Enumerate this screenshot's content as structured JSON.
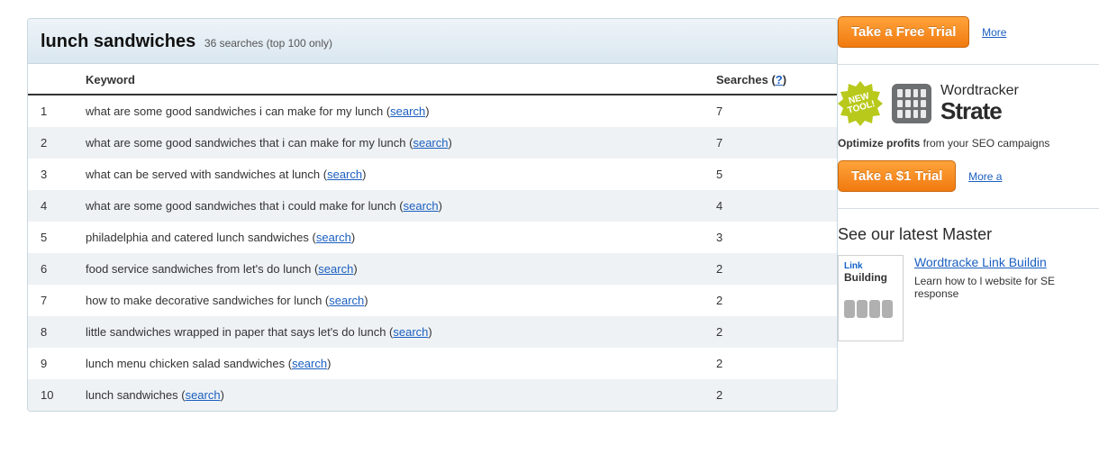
{
  "main": {
    "title": "lunch sandwiches",
    "subtitle": "36 searches (top 100 only)",
    "columns": {
      "keyword": "Keyword",
      "searches": "Searches",
      "help": "?"
    },
    "searchLinkLabel": "search",
    "rows": [
      {
        "rank": "1",
        "text": "what are some good sandwiches i can make for my lunch",
        "count": "7"
      },
      {
        "rank": "2",
        "text": "what are some good sandwiches that i can make for my lunch",
        "count": "7"
      },
      {
        "rank": "3",
        "text": "what can be served with sandwiches at lunch",
        "count": "5"
      },
      {
        "rank": "4",
        "text": "what are some good sandwiches that i could make for lunch",
        "count": "4"
      },
      {
        "rank": "5",
        "text": "philadelphia and catered lunch sandwiches",
        "count": "3"
      },
      {
        "rank": "6",
        "text": "food service sandwiches from let's do lunch",
        "count": "2"
      },
      {
        "rank": "7",
        "text": "how to make decorative sandwiches for lunch",
        "count": "2"
      },
      {
        "rank": "8",
        "text": "little sandwiches wrapped in paper that says let's do lunch",
        "count": "2"
      },
      {
        "rank": "9",
        "text": "lunch menu chicken salad sandwiches",
        "count": "2"
      },
      {
        "rank": "10",
        "text": "lunch sandwiches",
        "count": "2"
      }
    ]
  },
  "sidebar": {
    "freeTrialBtn": "Take a Free Trial",
    "more1": "More",
    "newToolBadge": {
      "l1": "NEW",
      "l2": "TOOL!"
    },
    "brand": {
      "line1": "Wordtracker",
      "line2": "Strate"
    },
    "optimizeLead": "Optimize profits",
    "optimizeRest": " from your SEO campaigns",
    "dollarTrialBtn": "Take a $1 Trial",
    "more2": "More a",
    "masterHeading": "See our latest Master",
    "mcThumb": {
      "t1": "Link",
      "t2": "Building"
    },
    "mcTitle": "Wordtracke Link Buildin",
    "mcDesc": "Learn how to l website for SE response"
  }
}
